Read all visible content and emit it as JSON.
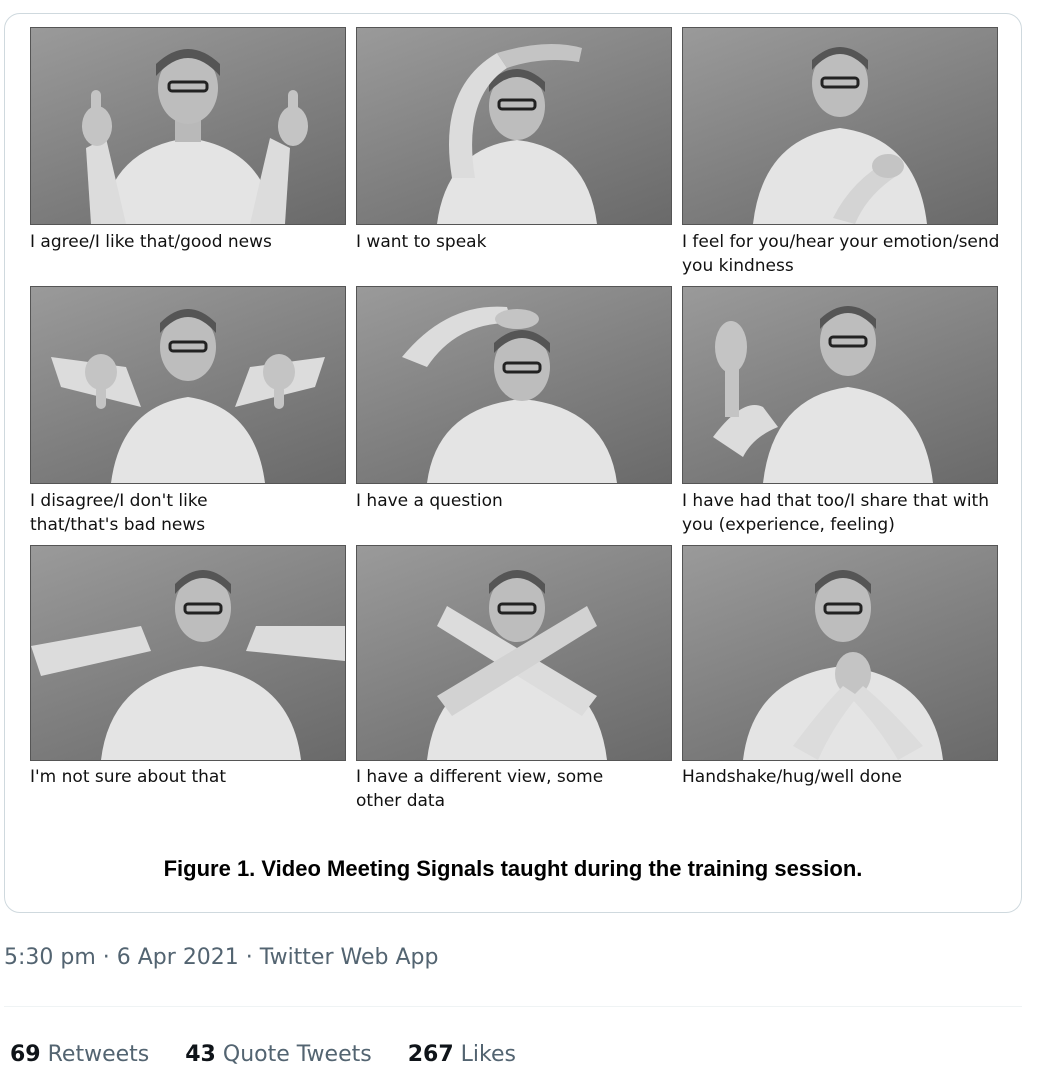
{
  "figure": {
    "panels": [
      {
        "caption": "I agree/I like that/good news",
        "gesture": "thumbs-up"
      },
      {
        "caption": "I want to speak",
        "gesture": "arm-raised-over-head"
      },
      {
        "caption": "I feel for you/hear your emotion/send you kindness",
        "gesture": "hand-on-heart"
      },
      {
        "caption": "I disagree/I don't like that/that's bad news",
        "gesture": "thumbs-down"
      },
      {
        "caption": "I have a question",
        "gesture": "hand-on-head"
      },
      {
        "caption": "I have had that too/I share that with you (experience, feeling)",
        "gesture": "open-palm-raised"
      },
      {
        "caption": "I'm not sure about that",
        "gesture": "hands-wobble"
      },
      {
        "caption": "I have a different view, some other data",
        "gesture": "crossed-arms"
      },
      {
        "caption": "Handshake/hug/well done",
        "gesture": "clasped-hands"
      }
    ],
    "title": "Figure 1. Video Meeting Signals taught during the training session."
  },
  "tweet": {
    "timestamp": "5:30 pm · 6 Apr 2021 · Twitter Web App",
    "stats": {
      "retweets_count": "69",
      "retweets_label": "Retweets",
      "quotes_count": "43",
      "quotes_label": "Quote Tweets",
      "likes_count": "267",
      "likes_label": "Likes"
    }
  },
  "colors": {
    "border": "#cfd9de",
    "muted_text": "#536471",
    "primary_text": "#0f1419"
  }
}
